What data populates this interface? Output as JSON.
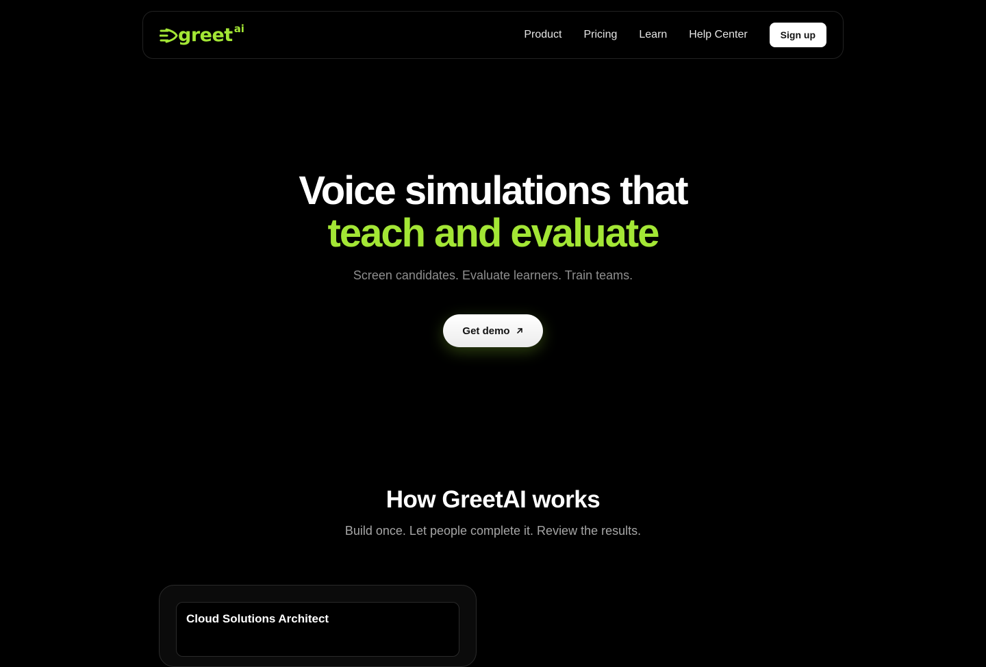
{
  "brand": {
    "name": "greet",
    "superscript": "ai",
    "accent_color": "#a3e635"
  },
  "nav": {
    "links": [
      "Product",
      "Pricing",
      "Learn",
      "Help Center"
    ],
    "signup_label": "Sign up"
  },
  "hero": {
    "title_line1": "Voice simulations that",
    "title_line2": "teach and evaluate",
    "subtitle": "Screen candidates. Evaluate learners. Train teams.",
    "cta_label": "Get demo",
    "cta_icon": "arrow-up-right-icon"
  },
  "how": {
    "title": "How GreetAI works",
    "subtitle": "Build once. Let people complete it. Review the results."
  },
  "preview": {
    "card_title": "Cloud Solutions Architect"
  }
}
